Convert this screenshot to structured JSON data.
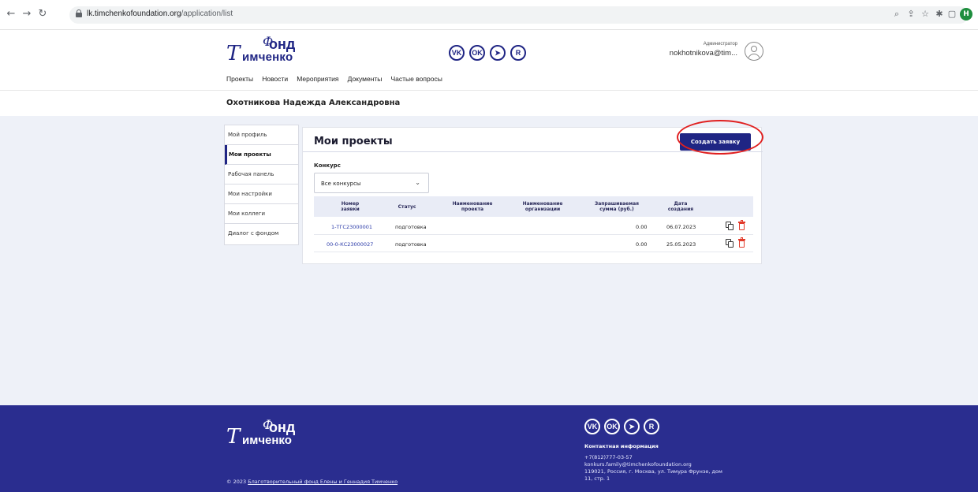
{
  "browser": {
    "url_host": "lk.timchenkofoundation.org",
    "url_path": "/application/list",
    "profile_initial": "H"
  },
  "header": {
    "logo": {
      "fond": "онд",
      "fond_ph": "Ф",
      "ph": "Т",
      "name": "имченко"
    },
    "social": [
      "VK",
      "OK",
      "TG",
      "R"
    ],
    "admin_role": "Администратор",
    "admin_email": "nokhotnikova@tim...",
    "nav": [
      "Проекты",
      "Новости",
      "Мероприятия",
      "Документы",
      "Частые вопросы"
    ]
  },
  "user_full_name": "Охотникова Надежда Александровна",
  "sidebar": {
    "items": [
      {
        "label": "Мой профиль"
      },
      {
        "label": "Мои проекты"
      },
      {
        "label": "Рабочая панель"
      },
      {
        "label": "Мои настройки"
      },
      {
        "label": "Мои коллеги"
      },
      {
        "label": "Диалог с фондом"
      }
    ]
  },
  "panel": {
    "title": "Мои проекты",
    "create_label": "Создать заявку",
    "filter_label": "Конкурс",
    "filter_value": "Все конкурсы"
  },
  "table": {
    "headers": {
      "number_1": "Номер",
      "number_2": "заявки",
      "status": "Статус",
      "project_1": "Наименование",
      "project_2": "проекта",
      "org_1": "Наименование",
      "org_2": "организации",
      "sum_1": "Запрашиваемая",
      "sum_2": "сумма (руб.)",
      "date_1": "Дата",
      "date_2": "создания"
    },
    "rows": [
      {
        "number": "1-ТГС23000001",
        "status": "подготовка",
        "project": "",
        "org": "",
        "sum": "0.00",
        "date": "06.07.2023"
      },
      {
        "number": "00-0-КС23000027",
        "status": "подготовка",
        "project": "",
        "org": "",
        "sum": "0.00",
        "date": "25.05.2023"
      }
    ]
  },
  "footer": {
    "logo": {
      "fond": "онд",
      "fond_ph": "Ф",
      "ph": "Т",
      "name": "имченко"
    },
    "contact_title": "Контактная информация",
    "phone": "+7(812)777-03-57",
    "email": "konkurs.family@timchenkofoundation.org",
    "address_1": "119021, Россия, г. Москва, ул. Тимура Фрунзе, дом",
    "address_2": "11, стр. 1",
    "copyright_prefix": "© 2023",
    "copyright_link": "Благотворительный фонд Елены и Геннадия Тимченко"
  },
  "colors": {
    "brand": "#1f2584",
    "footer": "#2a2d8f",
    "accent_red": "#e02020"
  }
}
